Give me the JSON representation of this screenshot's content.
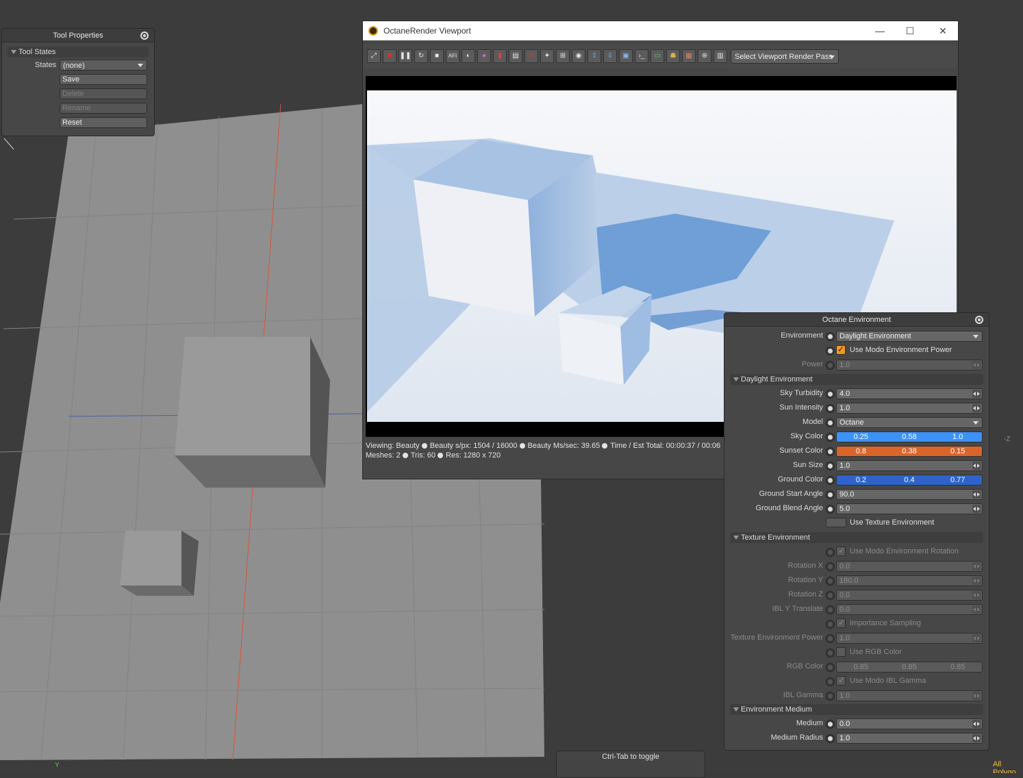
{
  "tool_properties": {
    "title": "Tool Properties",
    "section": "Tool States",
    "states_label": "States",
    "states_value": "(none)",
    "buttons": [
      "Save",
      "Delete",
      "Rename",
      "Reset"
    ],
    "disabled_buttons": [
      "Delete",
      "Rename"
    ]
  },
  "viewport3d": {
    "axis_neg_z": "+Z",
    "axis_right": "-Z",
    "axis_y": "Y",
    "corner_text": "All Polygo"
  },
  "octane_viewport": {
    "title": "OctaneRender Viewport",
    "toolbar_icons": [
      "fit-icon",
      "stop-red-icon",
      "pause-icon",
      "restart-icon",
      "stop-icon",
      "afi-icon",
      "clay-icon",
      "color-icon",
      "pick-icon",
      "region-icon",
      "no-icon",
      "focus-icon",
      "picker-icon",
      "camera-icon",
      "export-icon",
      "import-icon",
      "cube-icon",
      "console-icon",
      "monitor-icon",
      "paint-icon",
      "checker-icon",
      "film-icon",
      "doc-icon"
    ],
    "afi_label": "AFI",
    "render_pass_dropdown": "Select Viewport Render Pass",
    "status": {
      "viewing": "Viewing: Beauty",
      "spp": "Beauty s/px:  1504 / 16000",
      "ms": "Beauty Ms/sec: 39.65",
      "time": "Time / Est Total: 00:00:37 / 00:06",
      "meshes": "Meshes: 2",
      "tris": "Tris: 60",
      "res": "Res:  1280 x 720"
    }
  },
  "octane_environment": {
    "title": "Octane Environment",
    "environment_label": "Environment",
    "environment_value": "Daylight Environment",
    "use_modo_env_power": "Use Modo Environment Power",
    "power_label": "Power",
    "power_value": "1.0",
    "daylight_section": "Daylight Environment",
    "sky_turbidity_label": "Sky Turbidity",
    "sky_turbidity": "4.0",
    "sun_intensity_label": "Sun Intensity",
    "sun_intensity": "1.0",
    "model_label": "Model",
    "model_value": "Octane",
    "sky_color_label": "Sky Color",
    "sky_color": [
      "0.25",
      "0.58",
      "1.0"
    ],
    "sky_color_hex": "#3c92f6",
    "sunset_color_label": "Sunset Color",
    "sunset_color": [
      "0.8",
      "0.38",
      "0.15"
    ],
    "sunset_color_hex": "#d9652b",
    "sun_size_label": "Sun Size",
    "sun_size": "1.0",
    "ground_color_label": "Ground Color",
    "ground_color": [
      "0.2",
      "0.4",
      "0.77"
    ],
    "ground_color_hex": "#2f63c9",
    "ground_start_angle_label": "Ground Start Angle",
    "ground_start_angle": "90.0",
    "ground_blend_angle_label": "Ground Blend Angle",
    "ground_blend_angle": "5.0",
    "use_texture_env": "Use Texture Environment",
    "texture_section": "Texture Environment",
    "use_modo_env_rotation": "Use Modo Environment Rotation",
    "rotation_x_label": "Rotation X",
    "rotation_x": "0.0",
    "rotation_y_label": "Rotation Y",
    "rotation_y": "180.0",
    "rotation_z_label": "Rotation Z",
    "rotation_z": "0.0",
    "ibl_y_translate_label": "IBL Y Translate",
    "ibl_y_translate": "0.0",
    "importance_sampling": "Importance Sampling",
    "tex_env_power_label": "Texture Environment Power",
    "tex_env_power": "1.0",
    "use_rgb_color": "Use RGB Color",
    "rgb_color_label": "RGB Color",
    "rgb_color": [
      "0.85",
      "0.85",
      "0.85"
    ],
    "use_modo_ibl_gamma": "Use Modo IBL Gamma",
    "ibl_gamma_label": "IBL Gamma",
    "ibl_gamma": "1.0",
    "medium_section": "Environment Medium",
    "medium_label": "Medium",
    "medium": "0.0",
    "medium_radius_label": "Medium Radius",
    "medium_radius": "1.0"
  },
  "ctrl_tab": {
    "label": "Ctrl-Tab to toggle"
  }
}
